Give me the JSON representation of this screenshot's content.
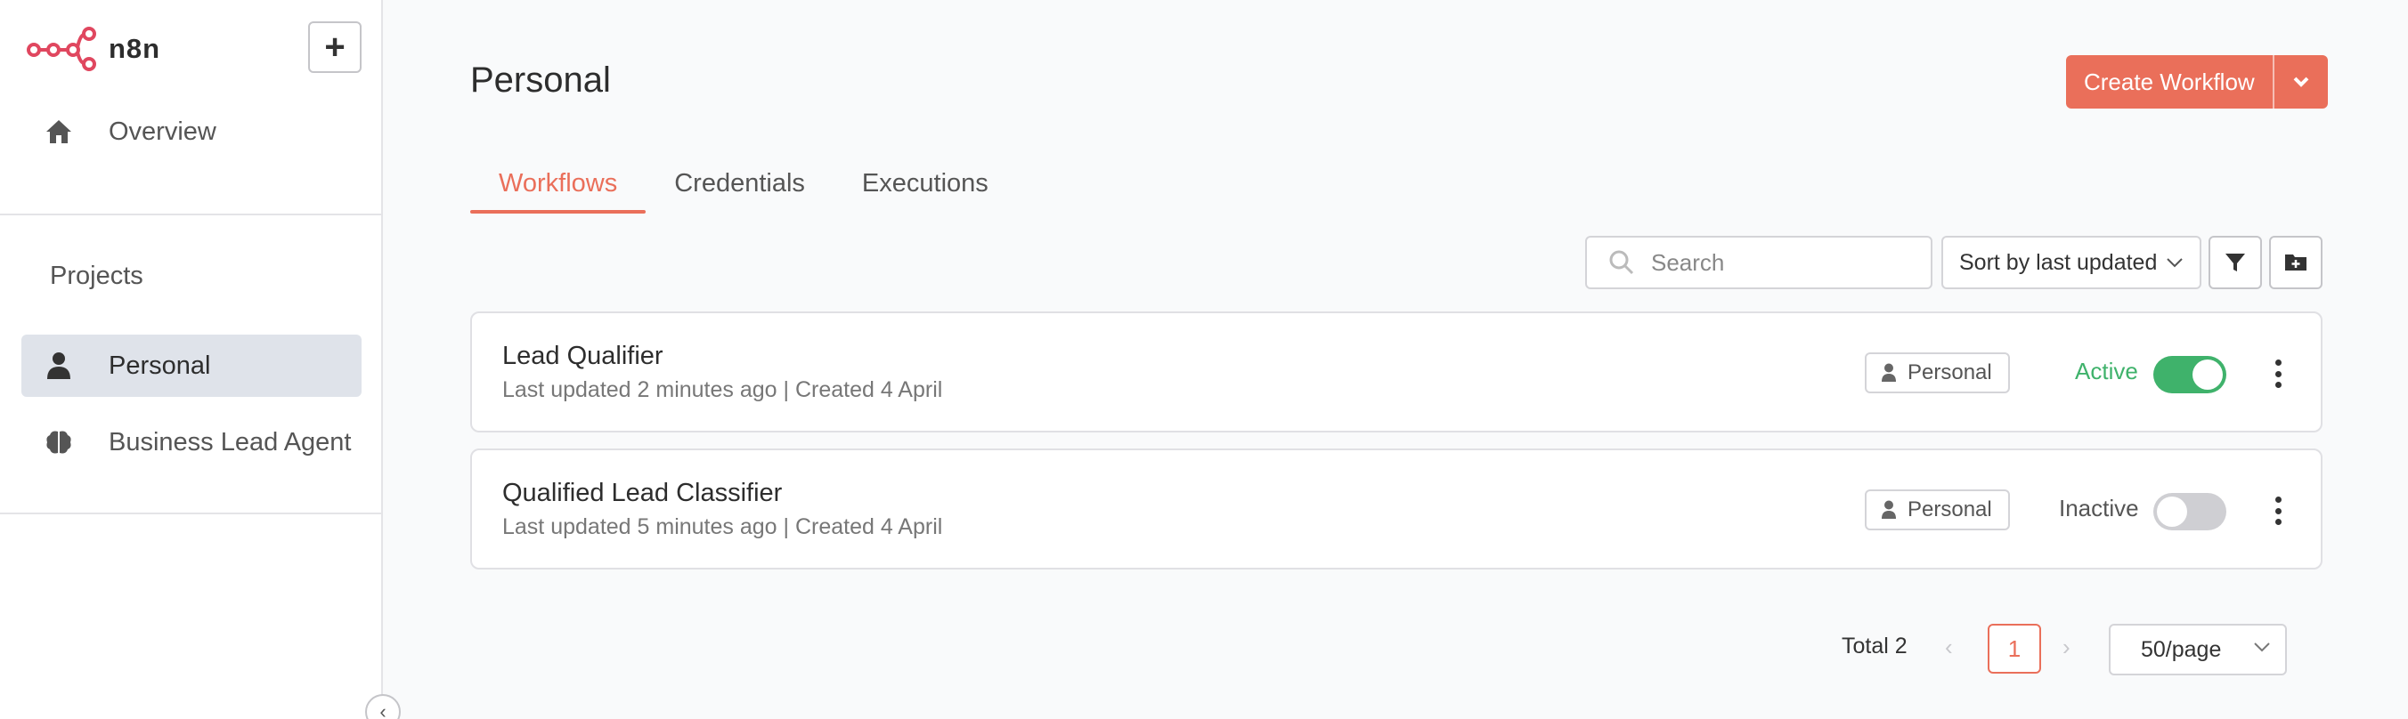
{
  "app": {
    "name": "n8n"
  },
  "sidebar": {
    "overview_label": "Overview",
    "projects_heading": "Projects",
    "projects": [
      {
        "label": "Personal",
        "icon": "user-icon",
        "active": true
      },
      {
        "label": "Business Lead Agent",
        "icon": "brain-icon",
        "active": false
      }
    ]
  },
  "header": {
    "title": "Personal",
    "create_button_label": "Create Workflow"
  },
  "tabs": [
    {
      "label": "Workflows",
      "active": true
    },
    {
      "label": "Credentials",
      "active": false
    },
    {
      "label": "Executions",
      "active": false
    }
  ],
  "toolbar": {
    "search_placeholder": "Search",
    "sort_value": "Sort by last updated"
  },
  "workflows": [
    {
      "name": "Lead Qualifier",
      "meta": "Last updated 2 minutes ago | Created 4 April",
      "project": "Personal",
      "status": "Active",
      "active": true
    },
    {
      "name": "Qualified Lead Classifier",
      "meta": "Last updated 5 minutes ago | Created 4 April",
      "project": "Personal",
      "status": "Inactive",
      "active": false
    }
  ],
  "pagination": {
    "total_label": "Total 2",
    "current_page": "1",
    "per_page": "50/page"
  },
  "colors": {
    "accent": "#ea6f5a",
    "active_green": "#3fb26b",
    "logo": "#e0475f"
  }
}
